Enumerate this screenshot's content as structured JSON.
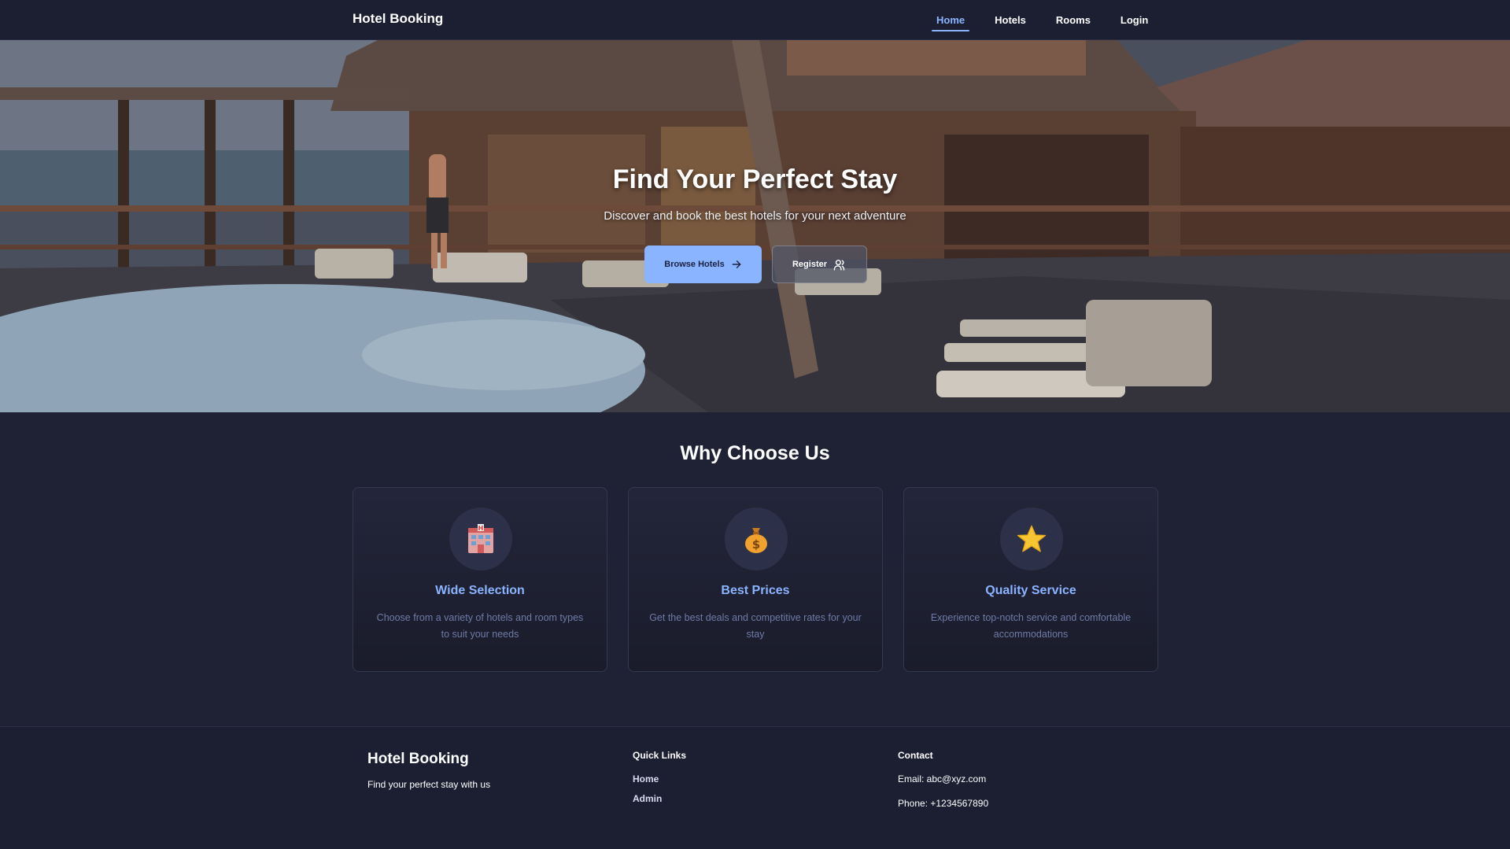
{
  "navbar": {
    "brand": "Hotel Booking",
    "links": [
      {
        "label": "Home",
        "active": true
      },
      {
        "label": "Hotels",
        "active": false
      },
      {
        "label": "Rooms",
        "active": false
      },
      {
        "label": "Login",
        "active": false
      }
    ]
  },
  "hero": {
    "title": "Find Your Perfect Stay",
    "subtitle": "Discover and book the best hotels for your next adventure",
    "primary_button": "Browse Hotels",
    "primary_button_icon": "arrow-right-icon",
    "secondary_button": "Register",
    "secondary_button_icon": "users-icon"
  },
  "features": {
    "title": "Why Choose Us",
    "cards": [
      {
        "icon": "hotel-icon",
        "title": "Wide Selection",
        "description": "Choose from a variety of hotels and room types to suit your needs"
      },
      {
        "icon": "money-bag-icon",
        "title": "Best Prices",
        "description": "Get the best deals and competitive rates for your stay"
      },
      {
        "icon": "star-icon",
        "title": "Quality Service",
        "description": "Experience top-notch service and comfortable accommodations"
      }
    ]
  },
  "footer": {
    "brand": "Hotel Booking",
    "tagline": "Find your perfect stay with us",
    "quick_links": {
      "heading": "Quick Links",
      "links": [
        "Home",
        "Admin"
      ]
    },
    "contact": {
      "heading": "Contact",
      "email": "Email: abc@xyz.com",
      "phone": "Phone: +1234567890"
    }
  },
  "colors": {
    "background": "#1f2235",
    "navbar": "#1c1f32",
    "accent": "#8ab4ff",
    "muted_text": "#6f7aa6",
    "card_border": "#34384f"
  }
}
